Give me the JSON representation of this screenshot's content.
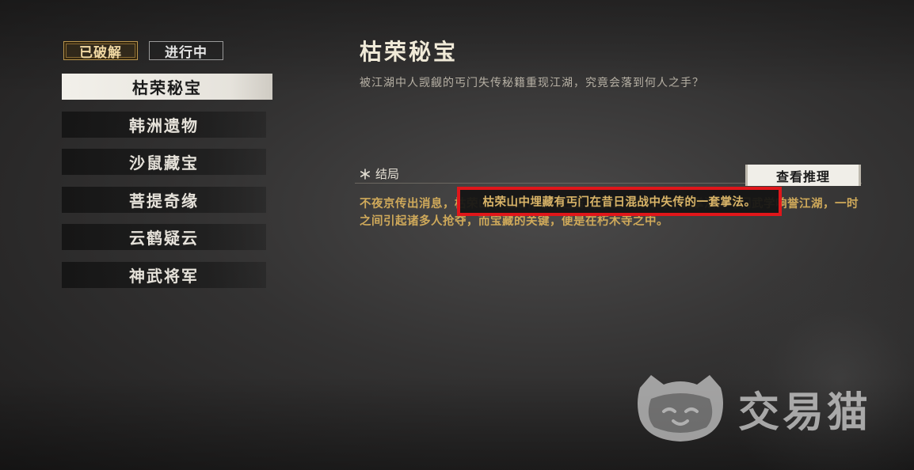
{
  "tabs": [
    {
      "label": "已破解",
      "active": true
    },
    {
      "label": "进行中",
      "active": false
    }
  ],
  "cases": [
    {
      "label": "枯荣秘宝",
      "selected": true
    },
    {
      "label": "韩洲遗物",
      "selected": false
    },
    {
      "label": "沙鼠藏宝",
      "selected": false
    },
    {
      "label": "菩提奇缘",
      "selected": false
    },
    {
      "label": "云鹤疑云",
      "selected": false
    },
    {
      "label": "神武将军",
      "selected": false
    }
  ],
  "detail": {
    "title": "枯荣秘宝",
    "description": "被江湖中人觊觎的丐门失传秘籍重现江湖，究竟会落到何人之手？",
    "section_label": "结局",
    "view_button": "查看推理",
    "result_text": "不夜京传出消息，枯荣山中埋藏有丐门在昔日混战中失传的一套掌法。丐门武学响誉江湖，一时之间引起诸多人抢夺，而宝藏的关键，便是在朽木寺之中。",
    "highlight_text": "枯荣山中埋藏有丐门在昔日混战中失传的一套掌法。"
  },
  "watermark": {
    "text": "交易猫",
    "icon": "cat-logo-icon"
  },
  "colors": {
    "gold": "#cfa95a",
    "highlight_red": "#e0161a"
  }
}
